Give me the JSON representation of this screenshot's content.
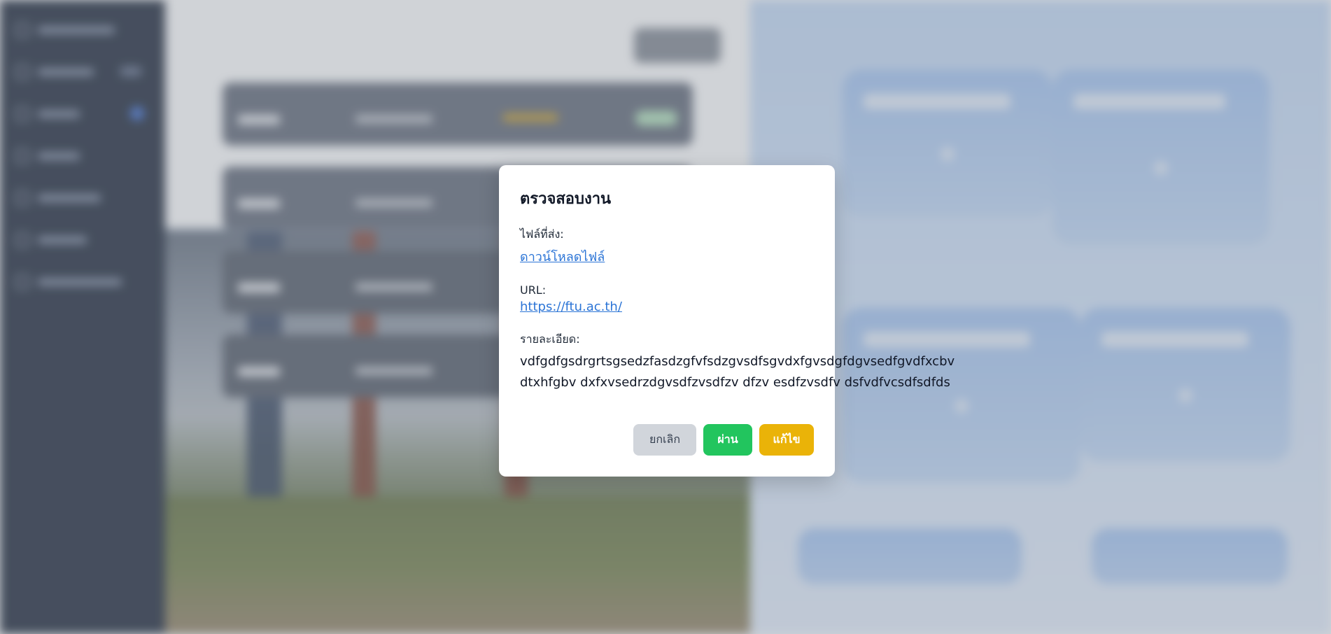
{
  "modal": {
    "title": "ตรวจสอบงาน",
    "file_label": "ไฟล์ที่ส่ง:",
    "file_link": "ดาวน์โหลดไฟล์",
    "url_label": "URL:",
    "url_value": "https://ftu.ac.th/",
    "detail_label": "รายละเอียด:",
    "detail_value": "vdfgdfgsdrgrtsgsedzfasdzgfvfsdzgvsdfsgvdxfgvsdgfdgvsedfgvdfxcbv dtxhfgbv dxfxvsedrzdgvsdfzvsdfzv dfzv esdfzvsdfv dsfvdfvcsdfsdfds",
    "buttons": {
      "cancel": "ยกเลิก",
      "pass": "ผ่าน",
      "edit": "แก้ไข"
    }
  },
  "colors": {
    "pass": "#22c55e",
    "edit": "#eab308",
    "cancel": "#d1d5db",
    "link": "#2b74d6"
  }
}
